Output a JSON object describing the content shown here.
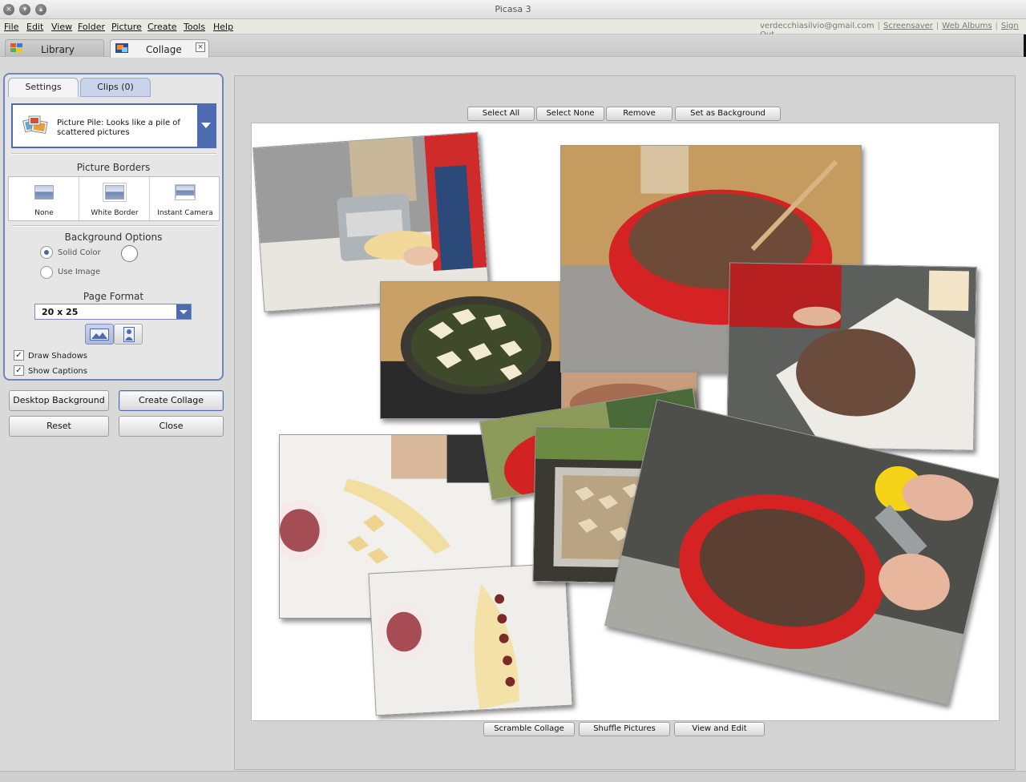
{
  "window": {
    "title": "Picasa 3",
    "controls": [
      "close-icon",
      "minimize-icon",
      "maximize-icon"
    ]
  },
  "menubar": {
    "items": [
      "File",
      "Edit",
      "View",
      "Folder",
      "Picture",
      "Create",
      "Tools",
      "Help"
    ],
    "account": {
      "email": "verdecchiasilvio@gmail.com",
      "links": [
        "Screensaver",
        "Web Albums",
        "Sign Out"
      ],
      "separator": "|"
    }
  },
  "tabs": [
    {
      "label": "Library",
      "icon": "library-grid-icon",
      "active": false
    },
    {
      "label": "Collage",
      "icon": "collage-icon",
      "active": true,
      "close": "×"
    }
  ],
  "sidebar": {
    "tabs": [
      "Settings",
      "Clips (0)"
    ],
    "layout": {
      "icon": "picture-pile-icon",
      "text": "Picture Pile:  Looks like a pile of scattered pictures"
    },
    "picture_borders": {
      "title": "Picture Borders",
      "options": [
        "None",
        "White Border",
        "Instant Camera"
      ]
    },
    "background": {
      "title": "Background Options",
      "options": [
        "Solid Color",
        "Use Image"
      ],
      "selected": "Solid Color",
      "color": "#ffffff"
    },
    "page_format": {
      "title": "Page Format",
      "value": "20 x 25",
      "orientation": "landscape"
    },
    "checkboxes": [
      {
        "label": "Draw Shadows",
        "checked": true,
        "mark": "✓"
      },
      {
        "label": "Show Captions",
        "checked": true,
        "mark": "✓"
      }
    ],
    "buttons": {
      "desktop_background": "Desktop Background",
      "create_collage": "Create Collage",
      "reset": "Reset",
      "close": "Close"
    }
  },
  "collage": {
    "top_buttons": [
      "Select All",
      "Select None",
      "Remove",
      "Set as Background"
    ],
    "bottom_buttons": [
      "Scramble Collage",
      "Shuffle Pictures",
      "View and Edit"
    ],
    "photo_count": 9
  },
  "colors": {
    "accent": "#4d6bb0",
    "panel_border": "#6d86bd",
    "canvas": "#ffffff"
  }
}
